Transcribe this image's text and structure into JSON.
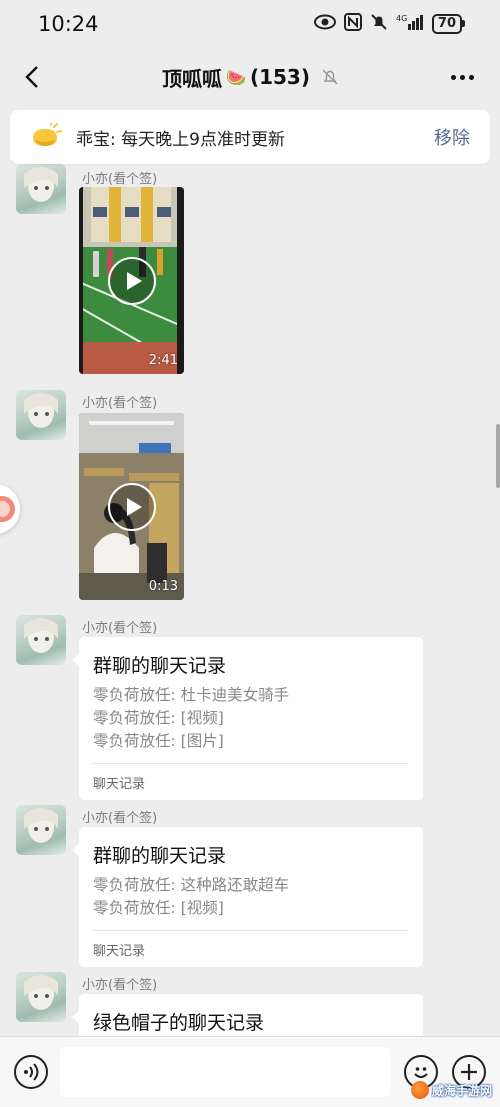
{
  "status_bar": {
    "time": "10:24",
    "network": "4G",
    "battery": "70"
  },
  "nav": {
    "title": "顶呱呱",
    "title_emoji": "🍉",
    "member_count": "(153)"
  },
  "notice": {
    "text": "乖宝: 每天晚上9点准时更新",
    "remove_label": "移除",
    "link_color": "#576b95"
  },
  "messages": [
    {
      "sender": "小亦(看个签)",
      "type": "video",
      "duration": "2:41"
    },
    {
      "sender": "小亦(看个签)",
      "type": "video",
      "duration": "0:13"
    },
    {
      "sender": "小亦(看个签)",
      "type": "chat_record",
      "title": "群聊的聊天记录",
      "lines": [
        "零负荷放任: 杜卡迪美女骑手",
        "零负荷放任: [视频]",
        "零负荷放任: [图片]"
      ],
      "footer": "聊天记录"
    },
    {
      "sender": "小亦(看个签)",
      "type": "chat_record",
      "title": "群聊的聊天记录",
      "lines": [
        "零负荷放任: 这种路还敢超车",
        "零负荷放任: [视频]"
      ],
      "footer": "聊天记录"
    },
    {
      "sender": "小亦(看个签)",
      "type": "chat_record",
      "title": "绿色帽子的聊天记录",
      "lines": [],
      "footer": ""
    }
  ],
  "partial_top_sender": "小亦(看个签)",
  "input": {
    "value": "",
    "placeholder": ""
  },
  "watermark": "威海手游网"
}
